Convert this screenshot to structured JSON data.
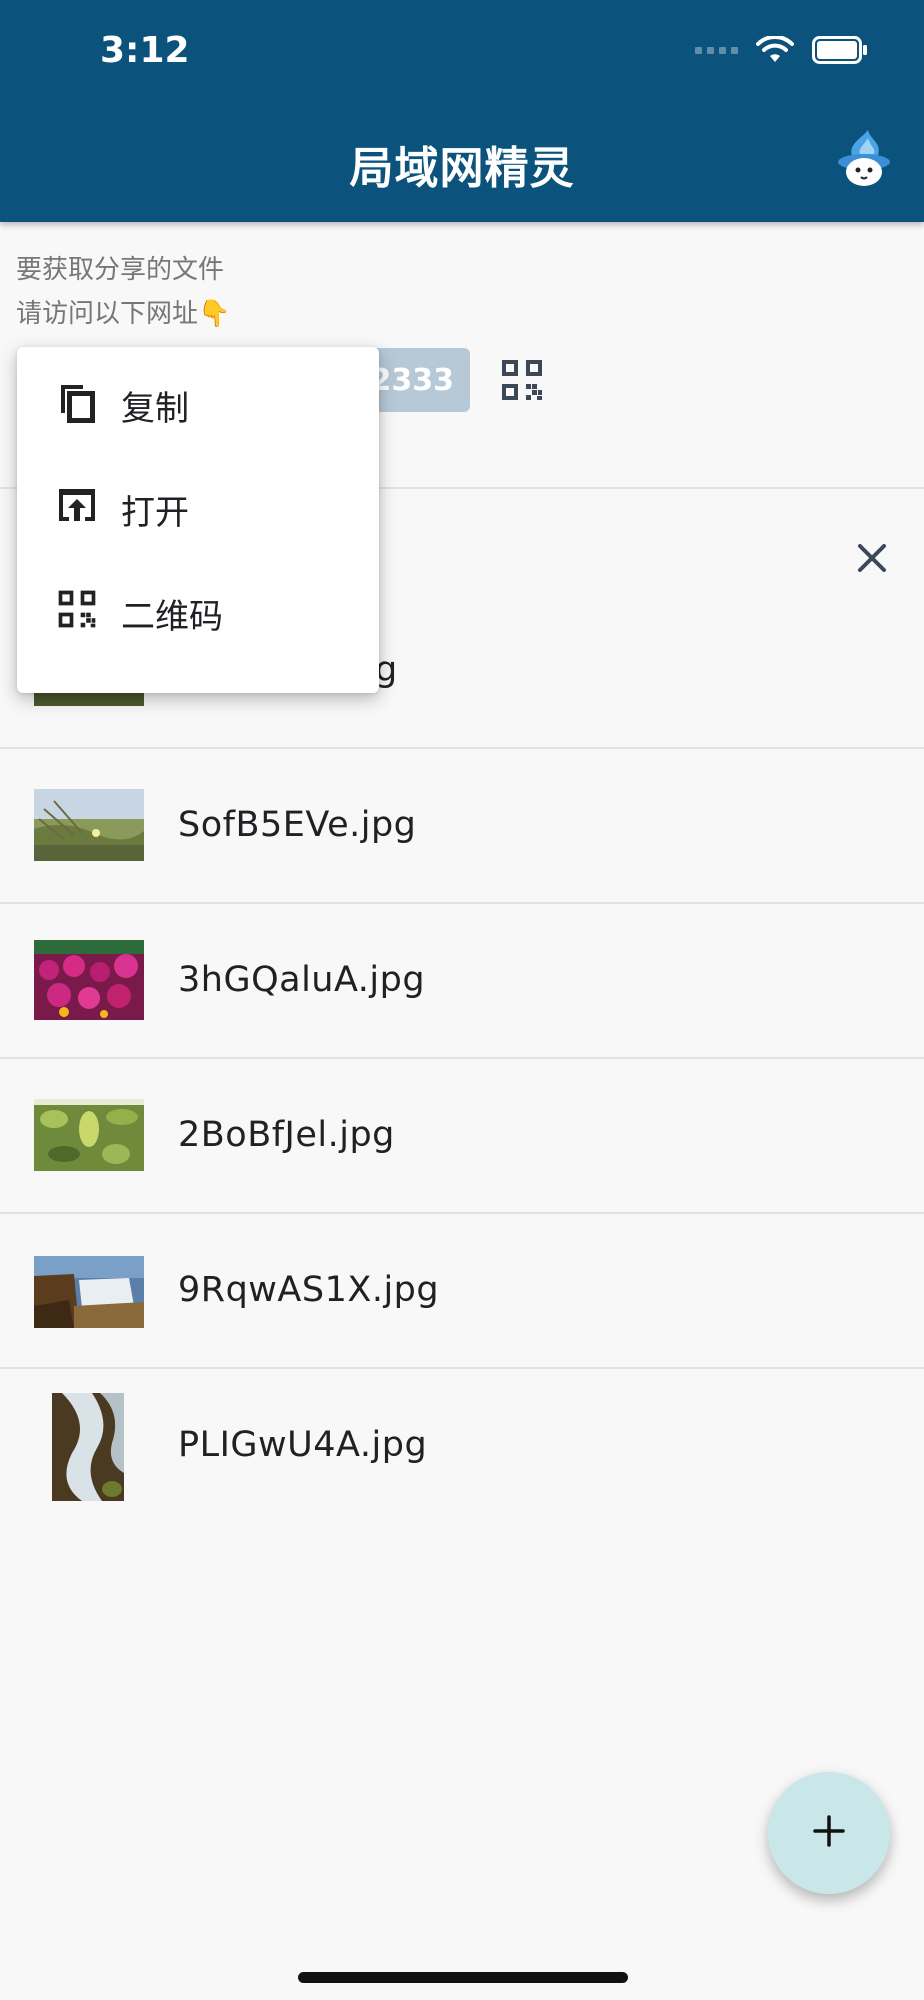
{
  "status_bar": {
    "time": "3:12"
  },
  "header": {
    "title": "局域网精灵"
  },
  "share": {
    "line1": "要获取分享的文件",
    "line2": "请访问以下网址👇",
    "url_partial": "2333"
  },
  "menu": {
    "items": [
      {
        "label": "复制",
        "icon": "copy-icon"
      },
      {
        "label": "打开",
        "icon": "open-in-browser-icon"
      },
      {
        "label": "二维码",
        "icon": "qr-code-icon"
      }
    ]
  },
  "files": {
    "partial_first": "g",
    "items": [
      {
        "name": "SofB5EVe.jpg"
      },
      {
        "name": "3hGQaluA.jpg"
      },
      {
        "name": "2BoBfJel.jpg"
      },
      {
        "name": "9RqwAS1X.jpg"
      },
      {
        "name": "PLIGwU4A.jpg"
      }
    ]
  },
  "colors": {
    "header_bg": "#0b527c",
    "fab_bg": "#c9e7e8",
    "url_chip_bg": "#b7c9d7"
  }
}
